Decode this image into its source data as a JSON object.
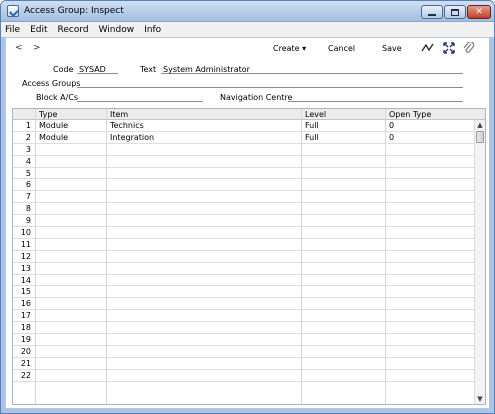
{
  "window": {
    "title": "Access Group: Inspect",
    "controls": {
      "minimize": "",
      "maximize": "",
      "close": "✕"
    }
  },
  "menubar": [
    "File",
    "Edit",
    "Record",
    "Window",
    "Info"
  ],
  "toolbar": {
    "prev": "<",
    "next": ">",
    "create": "Create",
    "cancel": "Cancel",
    "save": "Save",
    "icons": [
      "wave-icon",
      "expand-icon",
      "paperclip-icon"
    ]
  },
  "form": {
    "code_label": "Code",
    "code_value": "SYSAD",
    "text_label": "Text",
    "text_value": "System Administrator",
    "access_groups_label": "Access Groups",
    "access_groups_value": "",
    "block_acs_label": "Block A/Cs",
    "block_acs_value": "",
    "navigation_centre_label": "Navigation Centre",
    "navigation_centre_value": ""
  },
  "grid": {
    "columns": [
      "Type",
      "Item",
      "Level",
      "Open Type"
    ],
    "rows": [
      {
        "num": "1",
        "type": "Module",
        "item": "Technics",
        "level": "Full",
        "open": "0"
      },
      {
        "num": "2",
        "type": "Module",
        "item": "Integration",
        "level": "Full",
        "open": "0"
      },
      {
        "num": "3",
        "type": "",
        "item": "",
        "level": "",
        "open": ""
      },
      {
        "num": "4",
        "type": "",
        "item": "",
        "level": "",
        "open": ""
      },
      {
        "num": "5",
        "type": "",
        "item": "",
        "level": "",
        "open": ""
      },
      {
        "num": "6",
        "type": "",
        "item": "",
        "level": "",
        "open": ""
      },
      {
        "num": "7",
        "type": "",
        "item": "",
        "level": "",
        "open": ""
      },
      {
        "num": "8",
        "type": "",
        "item": "",
        "level": "",
        "open": ""
      },
      {
        "num": "9",
        "type": "",
        "item": "",
        "level": "",
        "open": ""
      },
      {
        "num": "10",
        "type": "",
        "item": "",
        "level": "",
        "open": ""
      },
      {
        "num": "11",
        "type": "",
        "item": "",
        "level": "",
        "open": ""
      },
      {
        "num": "12",
        "type": "",
        "item": "",
        "level": "",
        "open": ""
      },
      {
        "num": "13",
        "type": "",
        "item": "",
        "level": "",
        "open": ""
      },
      {
        "num": "14",
        "type": "",
        "item": "",
        "level": "",
        "open": ""
      },
      {
        "num": "15",
        "type": "",
        "item": "",
        "level": "",
        "open": ""
      },
      {
        "num": "16",
        "type": "",
        "item": "",
        "level": "",
        "open": ""
      },
      {
        "num": "17",
        "type": "",
        "item": "",
        "level": "",
        "open": ""
      },
      {
        "num": "18",
        "type": "",
        "item": "",
        "level": "",
        "open": ""
      },
      {
        "num": "19",
        "type": "",
        "item": "",
        "level": "",
        "open": ""
      },
      {
        "num": "20",
        "type": "",
        "item": "",
        "level": "",
        "open": ""
      },
      {
        "num": "21",
        "type": "",
        "item": "",
        "level": "",
        "open": ""
      },
      {
        "num": "22",
        "type": "",
        "item": "",
        "level": "",
        "open": ""
      }
    ]
  }
}
